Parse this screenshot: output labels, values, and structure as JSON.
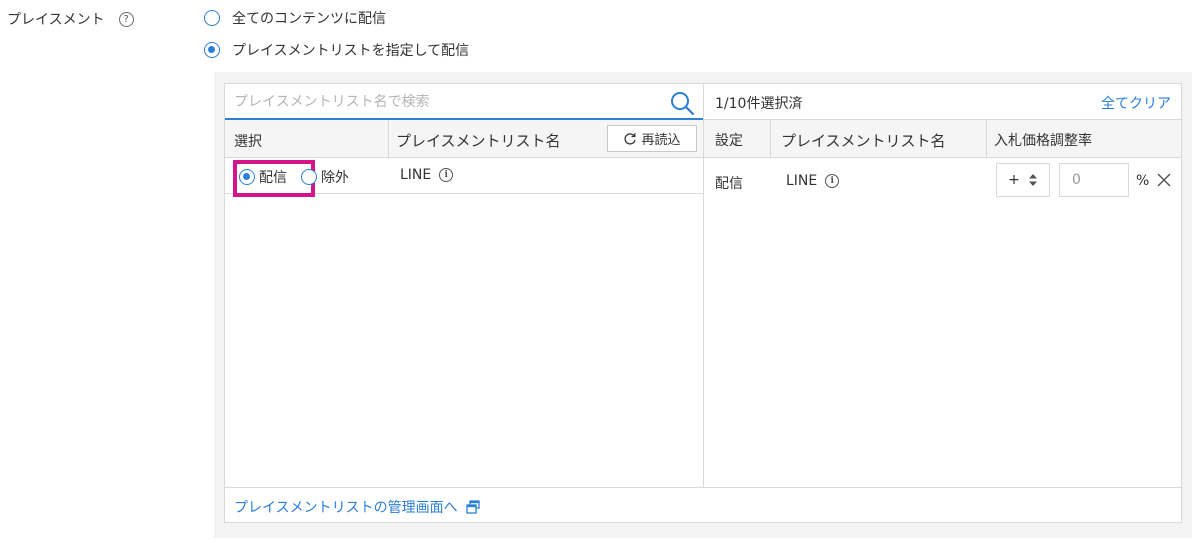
{
  "field": {
    "label": "プレイスメント",
    "help": "?"
  },
  "options": [
    {
      "label": "全てのコンテンツに配信",
      "selected": false
    },
    {
      "label": "プレイスメントリストを指定して配信",
      "selected": true
    }
  ],
  "left_panel": {
    "search_placeholder": "プレイスメントリスト名で検索",
    "headers": {
      "select": "選択",
      "name": "プレイスメントリスト名"
    },
    "reload_label": "再読込",
    "rows": [
      {
        "deliver_label": "配信",
        "exclude_label": "除外",
        "deliver_selected": true,
        "name": "LINE"
      }
    ]
  },
  "right_panel": {
    "count": "1/10件選択済",
    "clear_all": "全てクリア",
    "headers": {
      "setting": "設定",
      "name": "プレイスメントリスト名",
      "rate": "入札価格調整率"
    },
    "rows": [
      {
        "setting": "配信",
        "name": "LINE",
        "sign": "+",
        "rate_value": "0",
        "unit": "%"
      }
    ]
  },
  "footer": {
    "link_label": "プレイスメントリストの管理画面へ"
  },
  "colors": {
    "accent": "#2b7fd6",
    "highlight": "#d4148a",
    "border": "#d9d9d9"
  },
  "icons": {
    "info": "i",
    "search": "search-icon",
    "reload": "reload-icon",
    "remove": "close-icon",
    "external": "external-window-icon"
  }
}
